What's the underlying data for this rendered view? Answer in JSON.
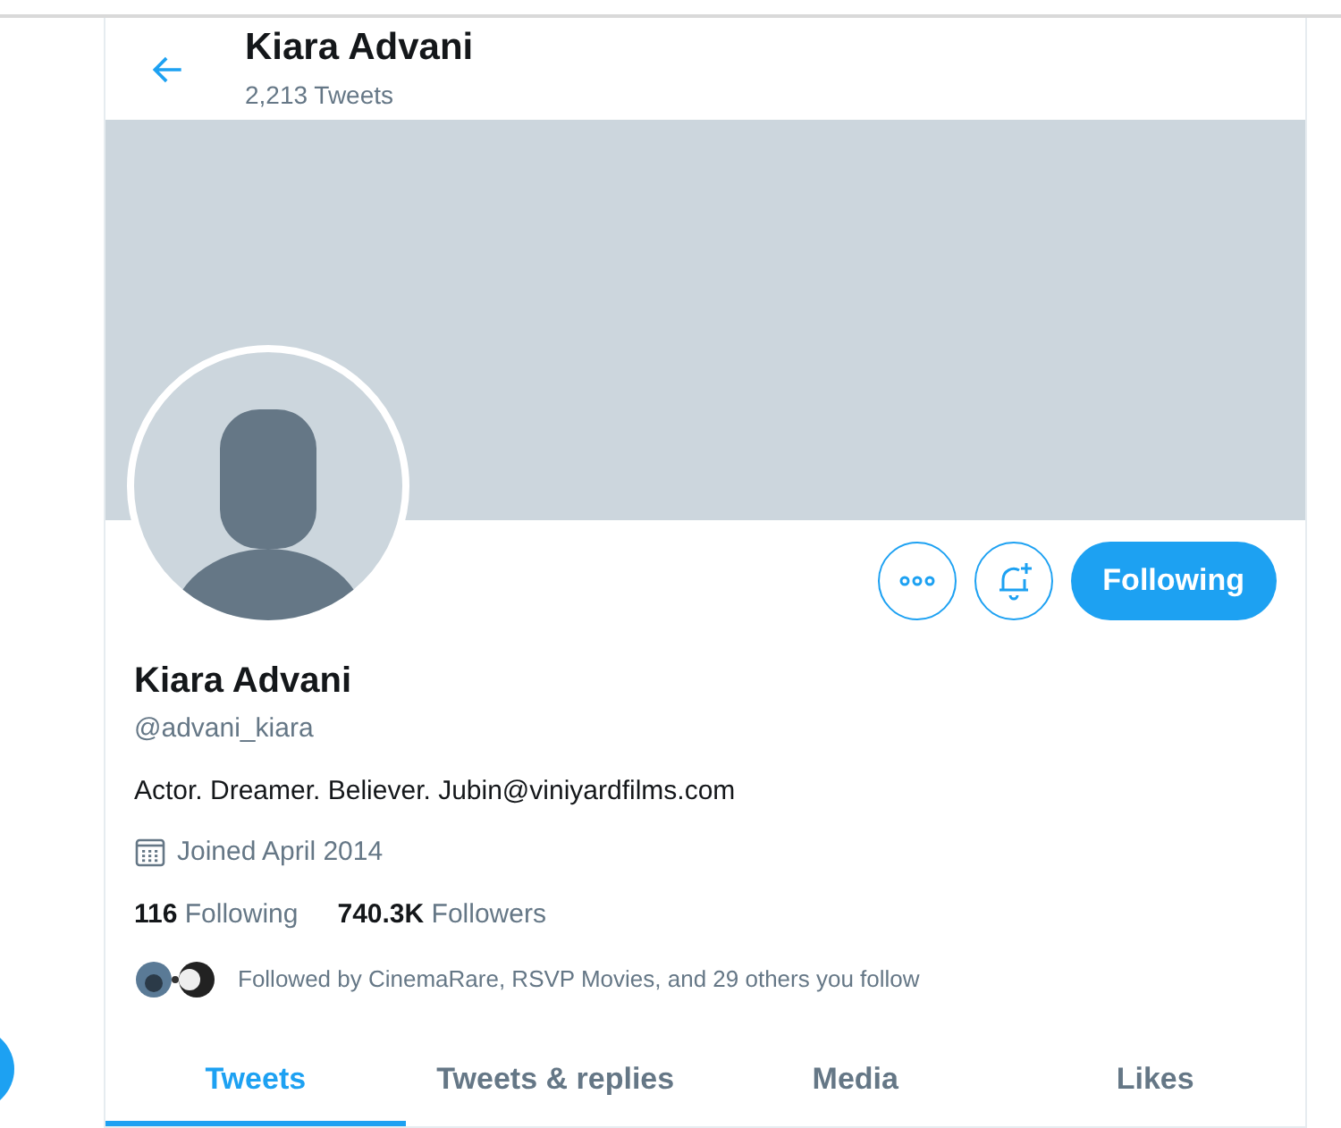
{
  "header": {
    "title": "Kiara Advani",
    "subtitle": "2,213 Tweets"
  },
  "profile": {
    "name": "Kiara Advani",
    "handle": "@advani_kiara",
    "bio": "Actor. Dreamer. Believer. Jubin@viniyardfilms.com",
    "joined": "Joined April 2014",
    "stats": [
      "**116** Following",
      "**740.3K** Followers"
    ],
    "followed_by": "Followed by CinemaRare, RSVP Movies, and 29 others you follow"
  },
  "follow_button": {
    "label": "Following",
    "on": true
  },
  "tabs": [
    {
      "label": "Tweets",
      "selected": true
    },
    {
      "label": "Tweets & replies",
      "selected": false
    },
    {
      "label": "Media",
      "selected": false
    },
    {
      "label": "Likes",
      "selected": false
    }
  ]
}
